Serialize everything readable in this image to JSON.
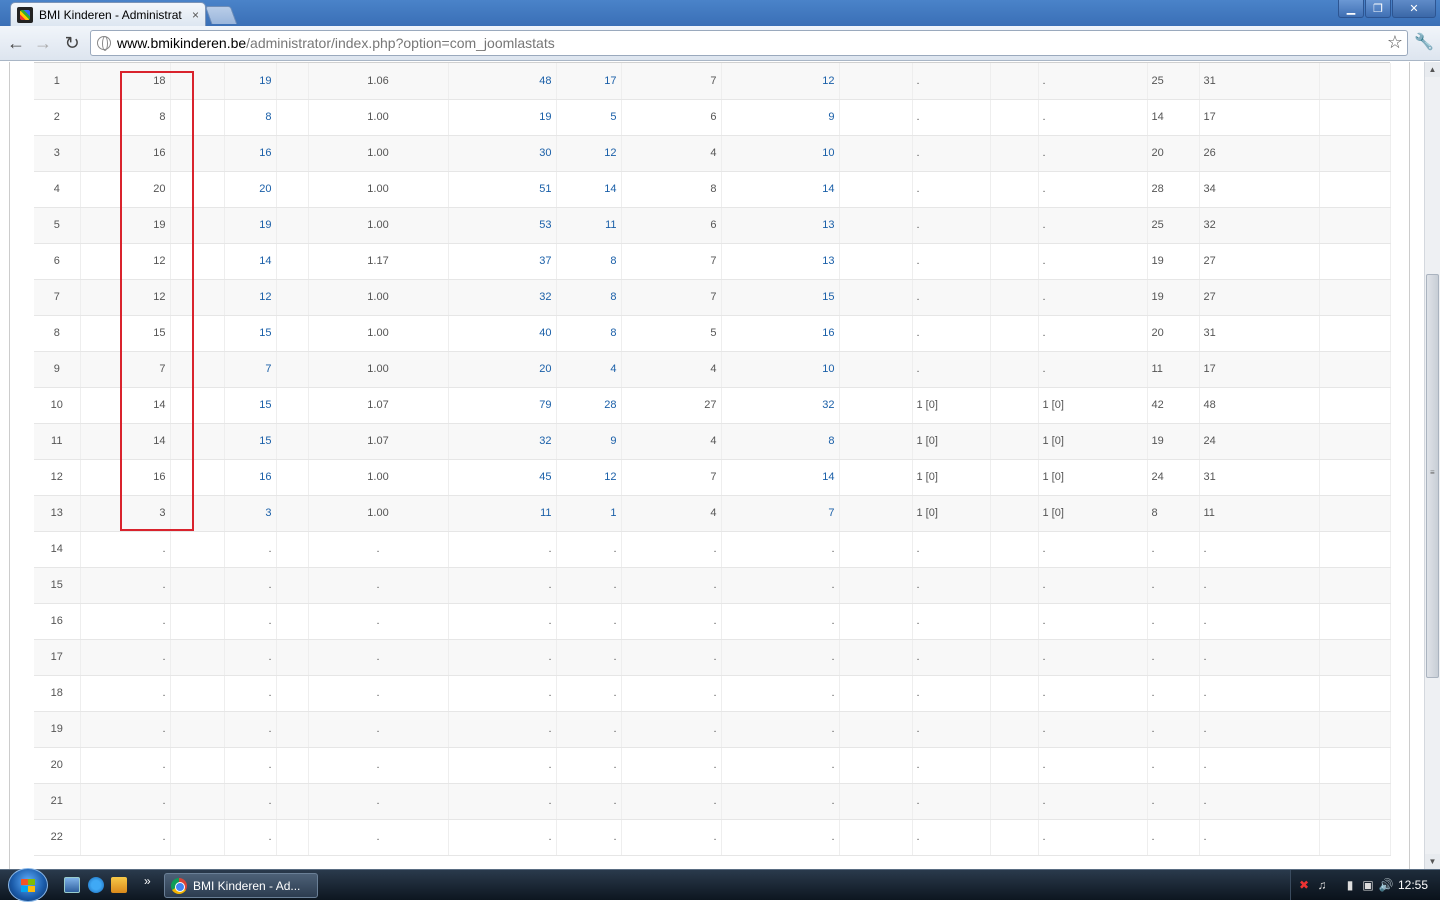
{
  "browser": {
    "tab_title": "BMI Kinderen - Administrat",
    "tab_close": "×",
    "url_host": "www.bmikinderen.be",
    "url_path": "/administrator/index.php?option=com_joomlastats",
    "window_buttons": {
      "minimize": "▁",
      "restore": "❐",
      "close": "✕"
    },
    "nav": {
      "back": "←",
      "forward": "→",
      "reload": "↻",
      "star": "☆",
      "wrench": "🔧"
    }
  },
  "table": {
    "rows": [
      [
        "1",
        "18",
        "19",
        "1.06",
        "48",
        "17",
        "7",
        "12",
        ".",
        ".",
        "25",
        "31"
      ],
      [
        "2",
        "8",
        "8",
        "1.00",
        "19",
        "5",
        "6",
        "9",
        ".",
        ".",
        "14",
        "17"
      ],
      [
        "3",
        "16",
        "16",
        "1.00",
        "30",
        "12",
        "4",
        "10",
        ".",
        ".",
        "20",
        "26"
      ],
      [
        "4",
        "20",
        "20",
        "1.00",
        "51",
        "14",
        "8",
        "14",
        ".",
        ".",
        "28",
        "34"
      ],
      [
        "5",
        "19",
        "19",
        "1.00",
        "53",
        "11",
        "6",
        "13",
        ".",
        ".",
        "25",
        "32"
      ],
      [
        "6",
        "12",
        "14",
        "1.17",
        "37",
        "8",
        "7",
        "13",
        ".",
        ".",
        "19",
        "27"
      ],
      [
        "7",
        "12",
        "12",
        "1.00",
        "32",
        "8",
        "7",
        "15",
        ".",
        ".",
        "19",
        "27"
      ],
      [
        "8",
        "15",
        "15",
        "1.00",
        "40",
        "8",
        "5",
        "16",
        ".",
        ".",
        "20",
        "31"
      ],
      [
        "9",
        "7",
        "7",
        "1.00",
        "20",
        "4",
        "4",
        "10",
        ".",
        ".",
        "11",
        "17"
      ],
      [
        "10",
        "14",
        "15",
        "1.07",
        "79",
        "28",
        "27",
        "32",
        "1 [0]",
        "1 [0]",
        "42",
        "48"
      ],
      [
        "11",
        "14",
        "15",
        "1.07",
        "32",
        "9",
        "4",
        "8",
        "1 [0]",
        "1 [0]",
        "19",
        "24"
      ],
      [
        "12",
        "16",
        "16",
        "1.00",
        "45",
        "12",
        "7",
        "14",
        "1 [0]",
        "1 [0]",
        "24",
        "31"
      ],
      [
        "13",
        "3",
        "3",
        "1.00",
        "11",
        "1",
        "4",
        "7",
        "1 [0]",
        "1 [0]",
        "8",
        "11"
      ],
      [
        "14",
        ".",
        ".",
        ".",
        ".",
        ".",
        ".",
        ".",
        ".",
        ".",
        ".",
        "."
      ],
      [
        "15",
        ".",
        ".",
        ".",
        ".",
        ".",
        ".",
        ".",
        ".",
        ".",
        ".",
        "."
      ],
      [
        "16",
        ".",
        ".",
        ".",
        ".",
        ".",
        ".",
        ".",
        ".",
        ".",
        ".",
        "."
      ],
      [
        "17",
        ".",
        ".",
        ".",
        ".",
        ".",
        ".",
        ".",
        ".",
        ".",
        ".",
        "."
      ],
      [
        "18",
        ".",
        ".",
        ".",
        ".",
        ".",
        ".",
        ".",
        ".",
        ".",
        ".",
        "."
      ],
      [
        "19",
        ".",
        ".",
        ".",
        ".",
        ".",
        ".",
        ".",
        ".",
        ".",
        ".",
        "."
      ],
      [
        "20",
        ".",
        ".",
        ".",
        ".",
        ".",
        ".",
        ".",
        ".",
        ".",
        ".",
        "."
      ],
      [
        "21",
        ".",
        ".",
        ".",
        ".",
        ".",
        ".",
        ".",
        ".",
        ".",
        ".",
        "."
      ],
      [
        "22",
        ".",
        ".",
        ".",
        ".",
        ".",
        ".",
        ".",
        ".",
        ".",
        ".",
        "."
      ]
    ]
  },
  "taskbar": {
    "more_label": "»",
    "task_item_label": "BMI Kinderen - Ad...",
    "clock": "12:55"
  },
  "colors": {
    "link": "#1a5fa8",
    "highlight": "#d9232d"
  }
}
